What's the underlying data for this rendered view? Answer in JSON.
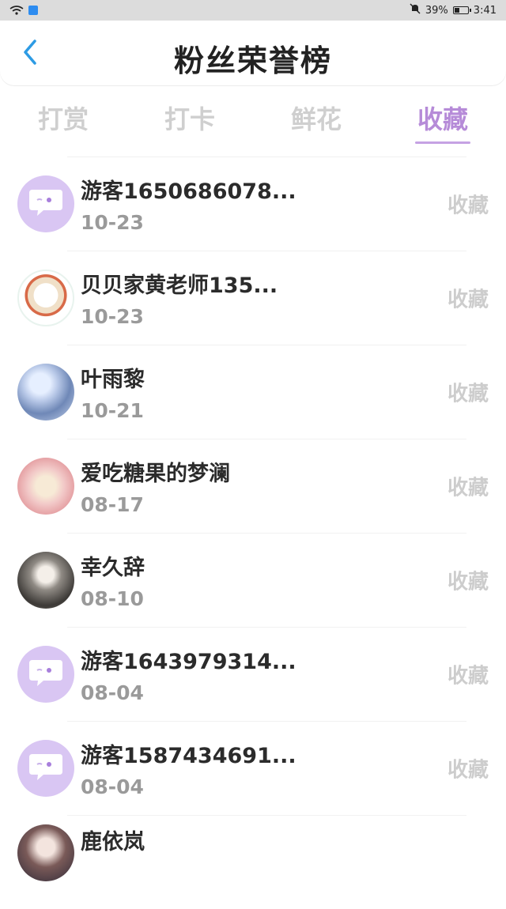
{
  "status_bar": {
    "battery_text": "39%",
    "time": "3:41",
    "battery_level": 0.39
  },
  "header": {
    "title": "粉丝荣誉榜"
  },
  "tabs": [
    {
      "label": "打赏",
      "active": false
    },
    {
      "label": "打卡",
      "active": false
    },
    {
      "label": "鲜花",
      "active": false
    },
    {
      "label": "收藏",
      "active": true
    }
  ],
  "list": [
    {
      "name": "游客1650686078...",
      "date": "10-23",
      "tag": "收藏",
      "avatar": "default"
    },
    {
      "name": "贝贝家黄老师135...",
      "date": "10-23",
      "tag": "收藏",
      "avatar": "logo"
    },
    {
      "name": "叶雨黎",
      "date": "10-21",
      "tag": "收藏",
      "avatar": "photo"
    },
    {
      "name": "爱吃糖果的梦澜",
      "date": "08-17",
      "tag": "收藏",
      "avatar": "photo"
    },
    {
      "name": "幸久辞",
      "date": "08-10",
      "tag": "收藏",
      "avatar": "photo"
    },
    {
      "name": "游客1643979314...",
      "date": "08-04",
      "tag": "收藏",
      "avatar": "default"
    },
    {
      "name": "游客1587434691...",
      "date": "08-04",
      "tag": "收藏",
      "avatar": "default"
    },
    {
      "name": "鹿依岚",
      "date": "",
      "tag": "",
      "avatar": "photo"
    }
  ],
  "colors": {
    "accent": "#b68bd8",
    "tab_inactive": "#cfcfcf",
    "avatar_default_bg": "#d9c6f3"
  },
  "icons": {
    "back": "chevron-left-icon",
    "wifi": "wifi-icon",
    "mute": "bell-off-icon",
    "battery": "battery-icon",
    "default_avatar": "chat-bubble-icon"
  }
}
